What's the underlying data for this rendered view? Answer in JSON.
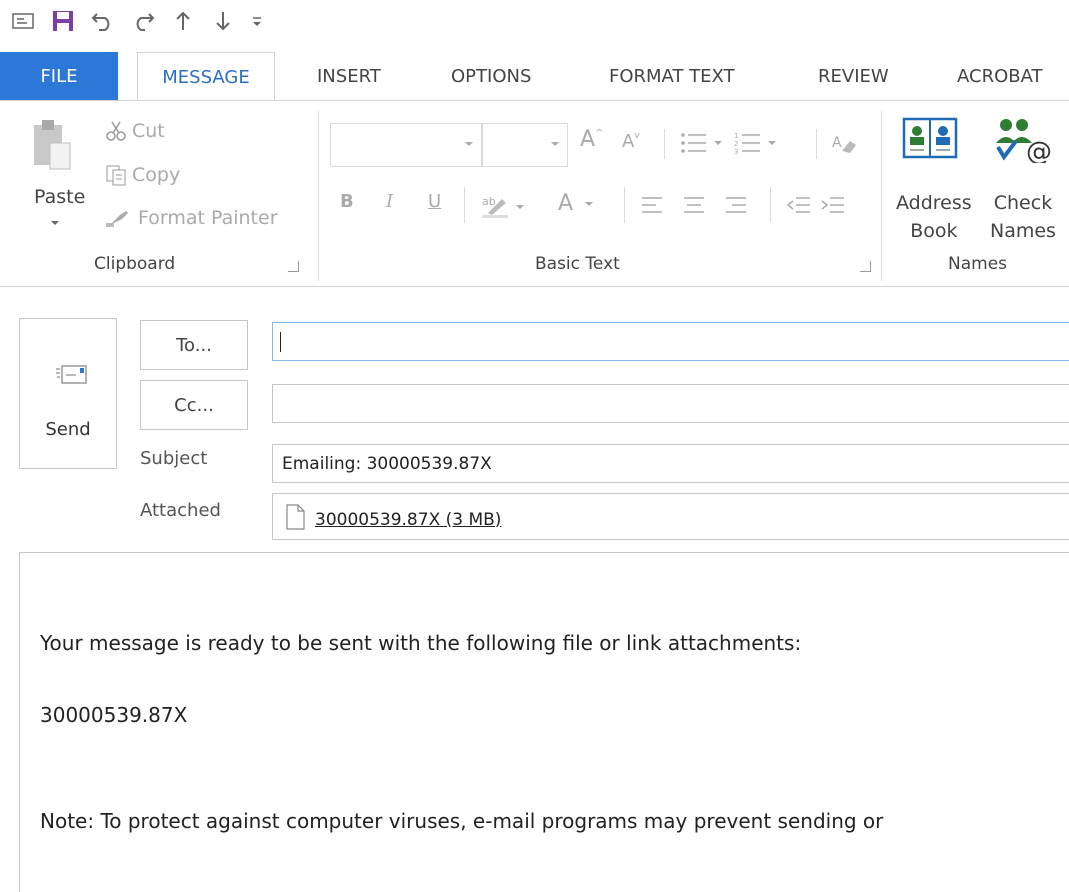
{
  "quick_access": {
    "icons": [
      "window-icon",
      "save-icon",
      "undo-icon",
      "redo-icon",
      "up-arrow-icon",
      "down-arrow-icon",
      "customize-qat-icon"
    ],
    "colors": {
      "save": "#7e3fa3"
    }
  },
  "tabs": [
    {
      "label": "FILE"
    },
    {
      "label": "MESSAGE"
    },
    {
      "label": "INSERT"
    },
    {
      "label": "OPTIONS"
    },
    {
      "label": "FORMAT TEXT"
    },
    {
      "label": "REVIEW"
    },
    {
      "label": "ACROBAT"
    }
  ],
  "ribbon": {
    "clipboard": {
      "label": "Clipboard",
      "paste": "Paste",
      "cut": "Cut",
      "copy": "Copy",
      "format_painter": "Format Painter"
    },
    "basic_text": {
      "label": "Basic Text",
      "bold": "B",
      "italic": "I",
      "underline": "U",
      "font_color": "A",
      "grow_font": "A",
      "shrink_font": "A"
    },
    "names": {
      "label": "Names",
      "address_book_line1": "Address",
      "address_book_line2": "Book",
      "check_names_line1": "Check",
      "check_names_line2": "Names"
    }
  },
  "header": {
    "send": "Send",
    "to_button": "To...",
    "cc_button": "Cc...",
    "to_value": "",
    "cc_value": "",
    "subject_label": "Subject",
    "subject_value": "Emailing: 30000539.87X",
    "attached_label": "Attached",
    "attachment": "30000539.87X (3 MB)"
  },
  "body": {
    "line1": "Your message is ready to be sent with the following file or link attachments:",
    "line2": "30000539.87X",
    "line3": "Note: To protect against computer viruses, e-mail programs may prevent sending or"
  },
  "colors": {
    "file_tab": "#2b78d6",
    "active_tab_text": "#2b6fc2",
    "focus_border": "#86b6e8"
  }
}
